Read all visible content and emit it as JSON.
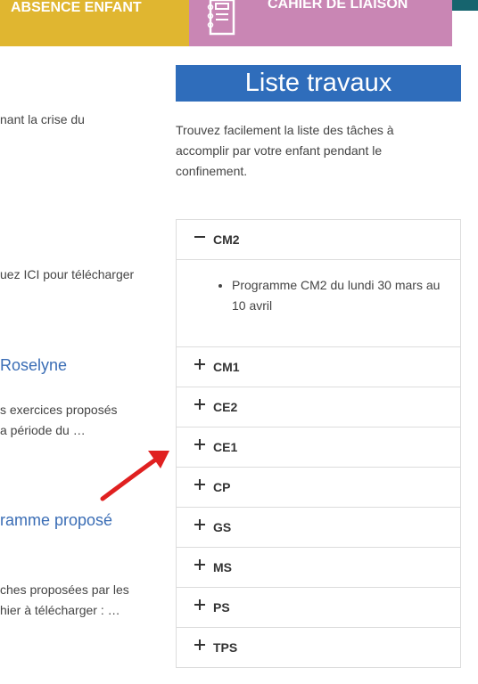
{
  "tabs": {
    "absence": "ABSENCE ENFANT",
    "cahier": "CAHIER DE LIAISON"
  },
  "left": {
    "text1": "nant la crise du",
    "text2": "uez ICI pour télécharger",
    "title1": "Roselyne",
    "text3": "s exercices proposés",
    "text4": "a période du …",
    "title2": "ramme proposé",
    "text5": "ches proposées par les",
    "text6": "hier à télécharger : …"
  },
  "sidebar": {
    "title": "Liste travaux",
    "description": "Trouvez facilement la liste des tâches à accomplir par votre enfant pendant le confinement.",
    "expanded": {
      "label": "CM2",
      "item": "Programme CM2 du lundi 30 mars au 10 avril"
    },
    "collapsed": [
      "CM1",
      "CE2",
      "CE1",
      "CP",
      "GS",
      "MS",
      "PS",
      "TPS"
    ]
  },
  "colors": {
    "absence_tab": "#e0b630",
    "cahier_tab": "#c986b4",
    "title_bar": "#2f6dbb",
    "arrow": "#e02020"
  },
  "icons": {
    "cahier": "notebook-icon",
    "expanded": "minus-icon",
    "collapsed": "plus-icon",
    "annotation": "red-arrow"
  }
}
